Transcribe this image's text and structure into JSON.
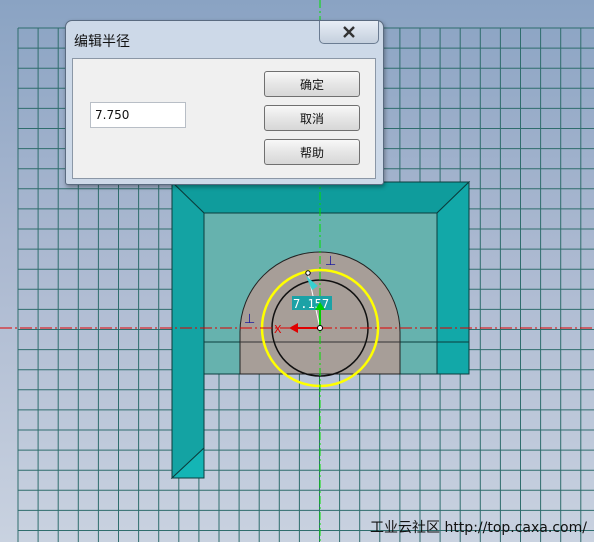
{
  "dialog": {
    "title": "编辑半径",
    "radius_value": "7.750",
    "ok_label": "确定",
    "cancel_label": "取消",
    "help_label": "帮助"
  },
  "canvas": {
    "dimension_value": "7.157",
    "x_axis_label": "X",
    "constraint_symbol": "⊥"
  },
  "watermark": "工业云社区 http://top.caxa.com/",
  "colors": {
    "grid_line": "#2f6d6d",
    "part_teal": "#17a5a5",
    "part_teal_light": "#66b2ae",
    "hole_flange": "#a79e98",
    "selected_circle": "#ffff00",
    "axis_green": "#00e000",
    "axis_red": "#e00000",
    "dimension_box": "#1ba2a6"
  }
}
